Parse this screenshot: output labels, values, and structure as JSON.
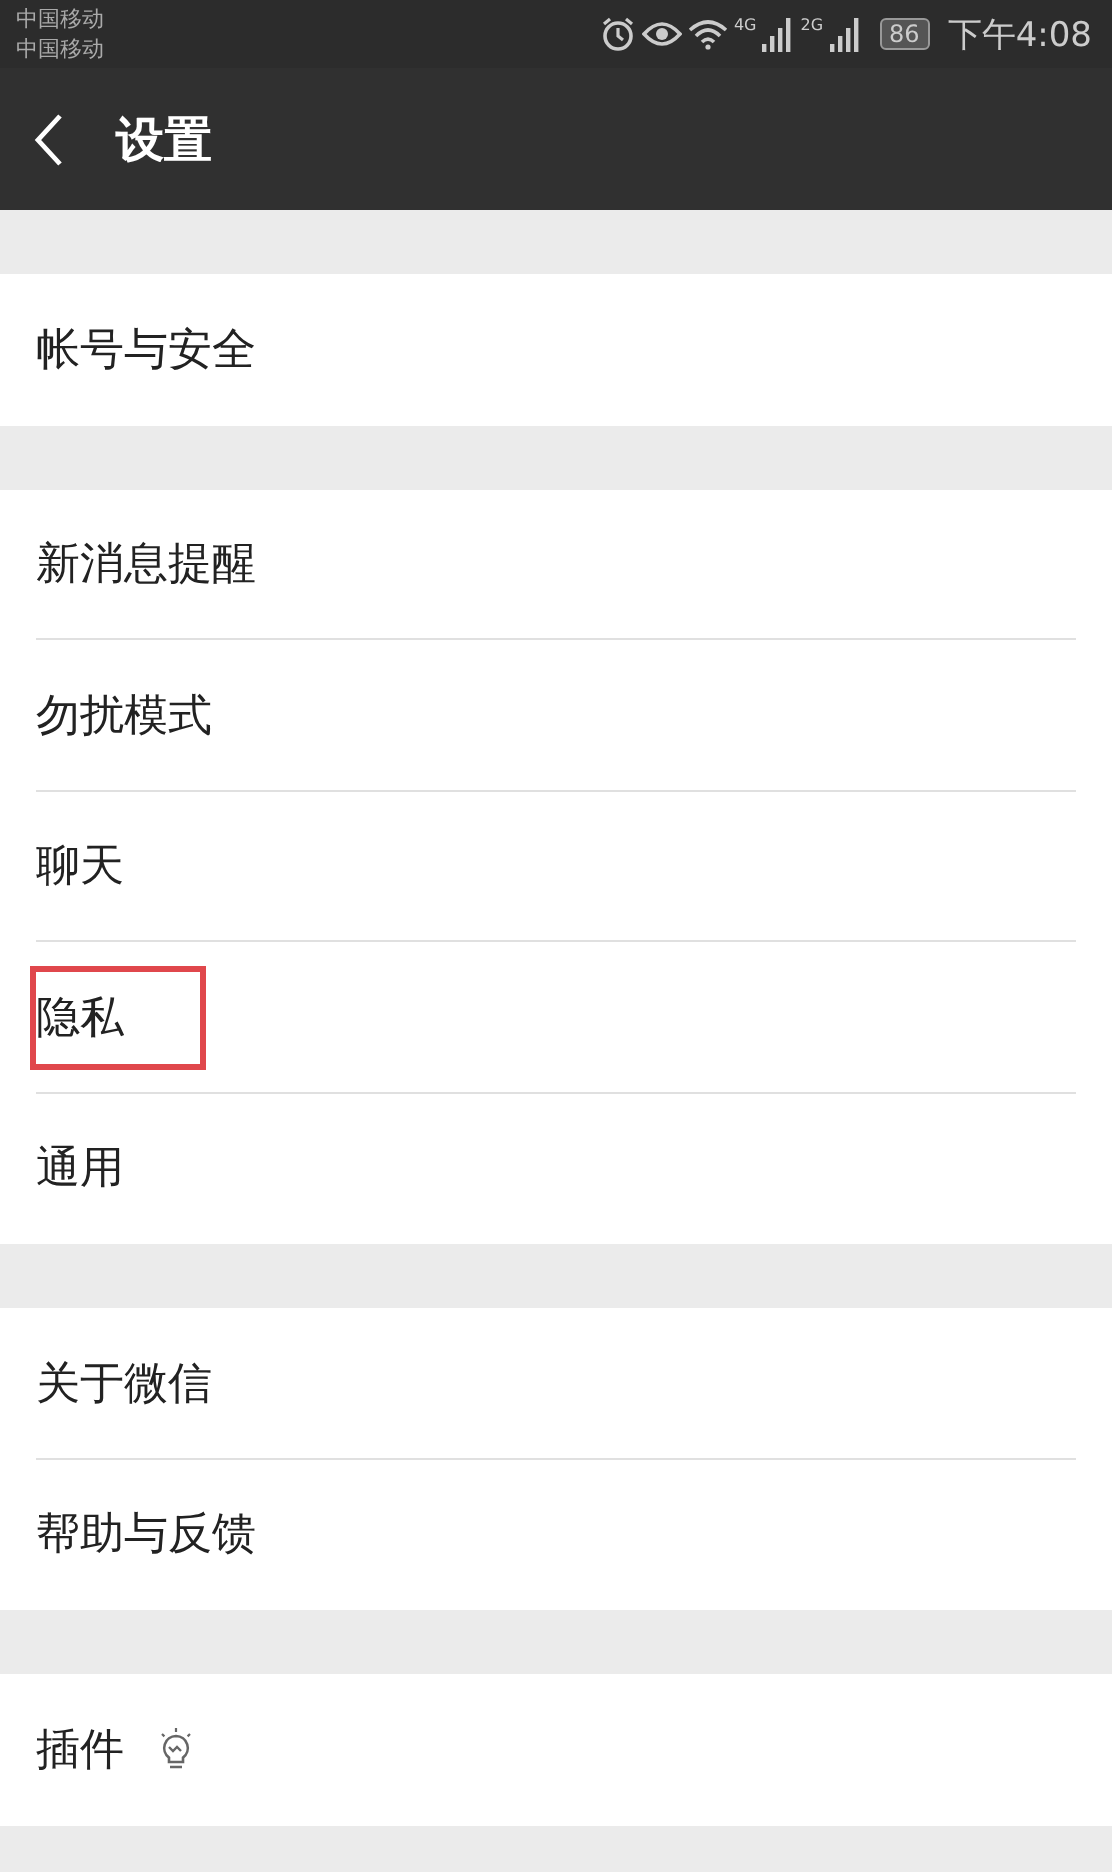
{
  "status_bar": {
    "carriers": [
      "中国移动",
      "中国移动"
    ],
    "networks": [
      "4G",
      "2G"
    ],
    "battery": "86",
    "time": "下午4:08"
  },
  "header": {
    "title": "设置"
  },
  "groups": [
    {
      "items": [
        {
          "label": "帐号与安全",
          "kind": "plain",
          "highlighted": false
        }
      ]
    },
    {
      "items": [
        {
          "label": "新消息提醒",
          "kind": "plain",
          "highlighted": false
        },
        {
          "label": "勿扰模式",
          "kind": "plain",
          "highlighted": false
        },
        {
          "label": "聊天",
          "kind": "plain",
          "highlighted": false
        },
        {
          "label": "隐私",
          "kind": "plain",
          "highlighted": true
        },
        {
          "label": "通用",
          "kind": "plain",
          "highlighted": false
        }
      ]
    },
    {
      "items": [
        {
          "label": "关于微信",
          "kind": "plain",
          "highlighted": false
        },
        {
          "label": "帮助与反馈",
          "kind": "plain",
          "highlighted": false
        }
      ]
    },
    {
      "items": [
        {
          "label": "插件",
          "kind": "with_icon",
          "highlighted": false
        }
      ]
    }
  ]
}
